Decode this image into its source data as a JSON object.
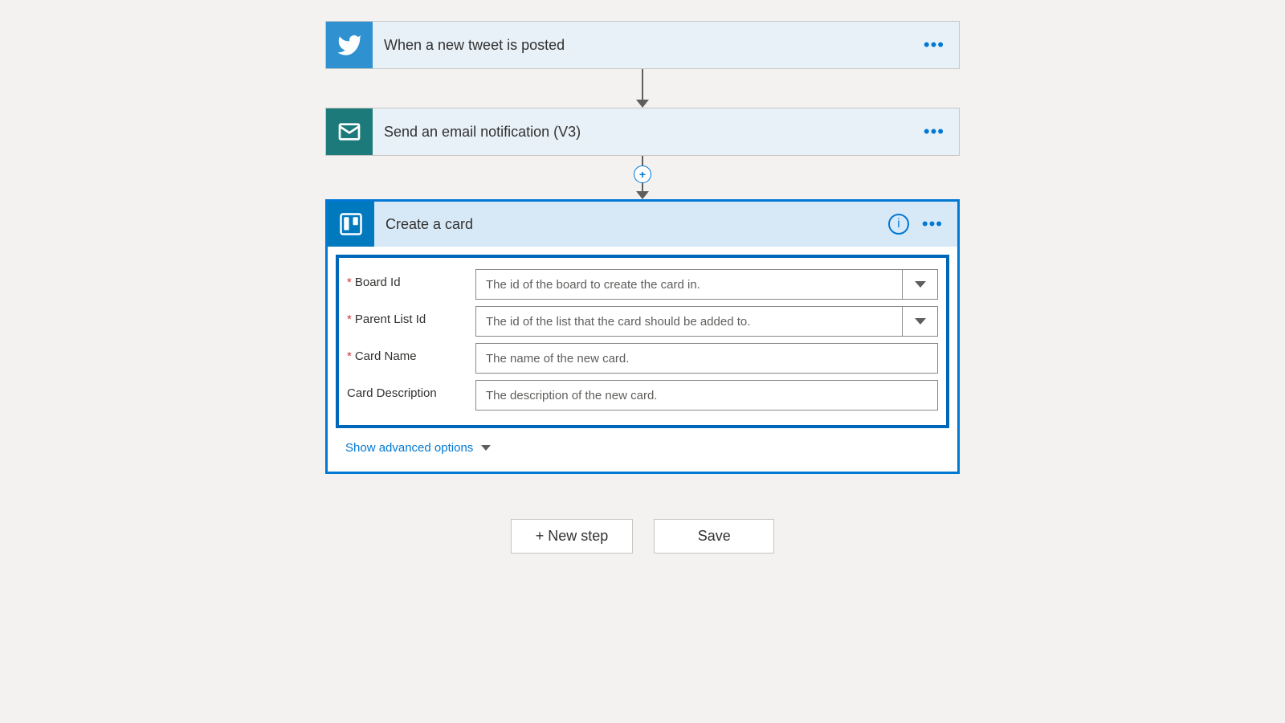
{
  "steps": {
    "trigger": {
      "title": "When a new tweet is posted"
    },
    "action1": {
      "title": "Send an email notification (V3)"
    },
    "action2": {
      "title": "Create a card",
      "fields": {
        "board_id": {
          "label": "Board Id",
          "required": true,
          "placeholder": "The id of the board to create the card in.",
          "dropdown": true
        },
        "parent_list": {
          "label": "Parent List Id",
          "required": true,
          "placeholder": "The id of the list that the card should be added to.",
          "dropdown": true
        },
        "card_name": {
          "label": "Card Name",
          "required": true,
          "placeholder": "The name of the new card.",
          "dropdown": false
        },
        "card_desc": {
          "label": "Card Description",
          "required": false,
          "placeholder": "The description of the new card.",
          "dropdown": false
        }
      },
      "advanced": "Show advanced options"
    }
  },
  "footer": {
    "new_step": "+ New step",
    "save": "Save"
  }
}
